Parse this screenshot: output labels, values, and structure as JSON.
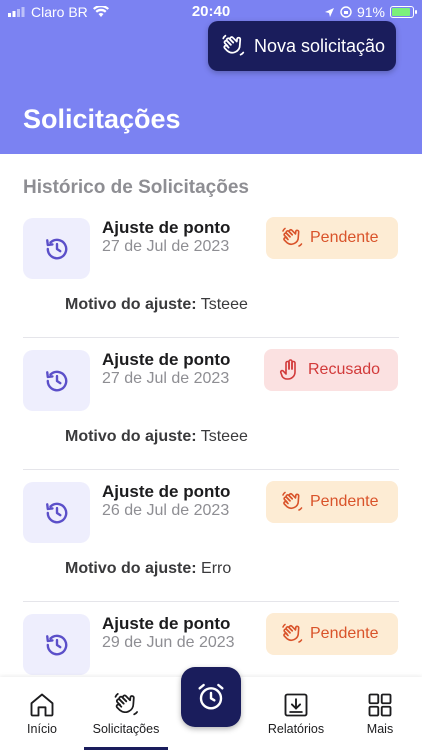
{
  "status_bar": {
    "carrier": "Claro BR",
    "time": "20:40",
    "battery": "91%"
  },
  "header": {
    "new_request_label": "Nova solicitação",
    "title": "Solicitações"
  },
  "section_title": "Histórico de Solicitações",
  "motive_label": "Motivo do ajuste:",
  "requests": [
    {
      "title": "Ajuste de ponto",
      "date": "27 de Jul de 2023",
      "status": "Pendente",
      "motive": "Tsteee"
    },
    {
      "title": "Ajuste de ponto",
      "date": "27 de Jul de 2023",
      "status": "Recusado",
      "motive": "Tsteee"
    },
    {
      "title": "Ajuste de ponto",
      "date": "26 de Jul de 2023",
      "status": "Pendente",
      "motive": "Erro"
    },
    {
      "title": "Ajuste de ponto",
      "date": "29 de Jun de 2023",
      "status": "Pendente",
      "motive": ""
    }
  ],
  "nav": {
    "inicio": "Início",
    "solicitacoes": "Solicitações",
    "relatorios": "Relatórios",
    "mais": "Mais"
  },
  "colors": {
    "header_bg": "#7b82f2",
    "primary_dark": "#1a1d5c",
    "pendente_bg": "#fdecd4",
    "pendente_fg": "#d9532a",
    "recusado_bg": "#fbe1e1",
    "recusado_fg": "#d23a3a"
  }
}
